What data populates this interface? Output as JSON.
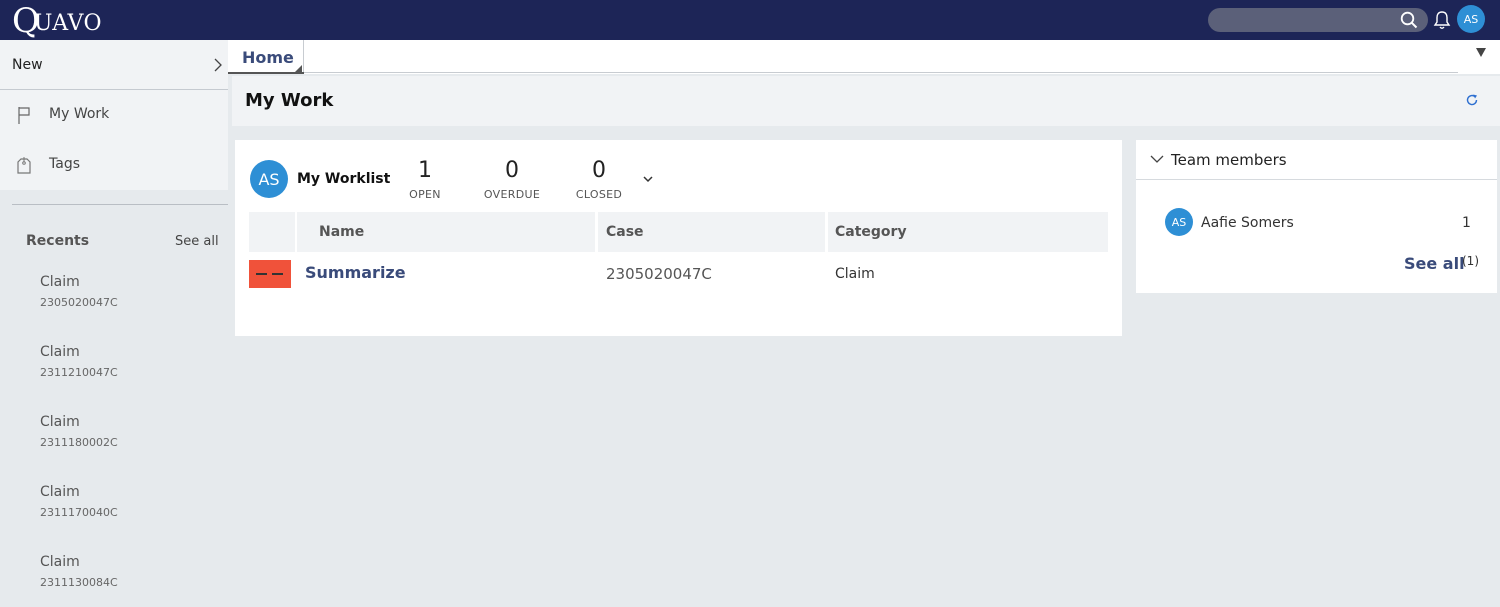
{
  "topbar": {
    "logo_q": "Q",
    "logo_rest": "UAVO",
    "search_placeholder": "",
    "user_initials": "AS"
  },
  "sidebar": {
    "new_label": "New",
    "items": [
      {
        "label": "My Work",
        "icon": "flag-icon"
      },
      {
        "label": "Tags",
        "icon": "tag-icon"
      }
    ],
    "recents_title": "Recents",
    "recents_see_all": "See all",
    "recents": [
      {
        "title": "Claim",
        "id": "2305020047C"
      },
      {
        "title": "Claim",
        "id": "2311210047C"
      },
      {
        "title": "Claim",
        "id": "2311180002C"
      },
      {
        "title": "Claim",
        "id": "2311170040C"
      },
      {
        "title": "Claim",
        "id": "2311130084C"
      }
    ]
  },
  "tabs": [
    {
      "label": "Home"
    }
  ],
  "main": {
    "title": "My Work",
    "worklist": {
      "initials": "AS",
      "title": "My Worklist",
      "counts": [
        {
          "value": "1",
          "label": "OPEN"
        },
        {
          "value": "0",
          "label": "OVERDUE"
        },
        {
          "value": "0",
          "label": "CLOSED"
        }
      ],
      "columns": [
        "Name",
        "Case",
        "Category"
      ],
      "rows": [
        {
          "name": "Summarize",
          "case": "2305020047C",
          "category": "Claim",
          "flag_color": "#f0523a"
        }
      ]
    },
    "team": {
      "title": "Team members",
      "members": [
        {
          "initials": "AS",
          "name": "Aafie Somers",
          "count": "1"
        }
      ],
      "see_all": "See all",
      "see_all_count": "(1)"
    }
  },
  "colors": {
    "topbar": "#1d2557",
    "accent": "#3a4b7a",
    "avatar": "#2e8fd5",
    "urgent": "#f0523a"
  }
}
